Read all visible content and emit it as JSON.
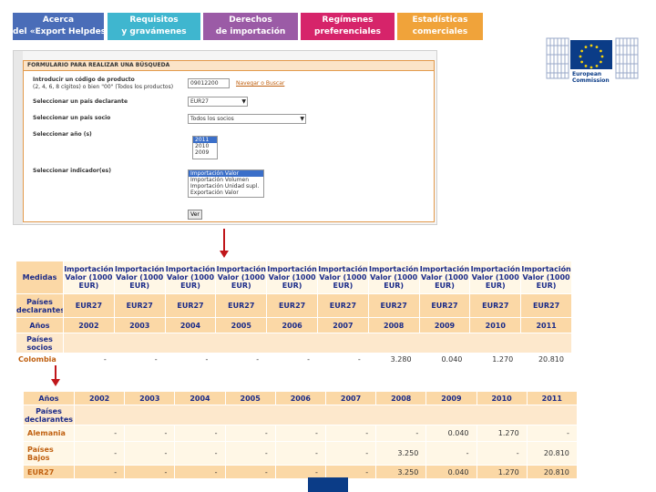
{
  "nav": {
    "tabs": [
      {
        "line1": "Acerca",
        "line2": "del «Export Helpdesk»",
        "color": "#4a6db8"
      },
      {
        "line1": "Requisitos",
        "line2": "y gravámenes",
        "color": "#3fb6cf"
      },
      {
        "line1": "Derechos",
        "line2": "de importación",
        "color": "#9b5ba6"
      },
      {
        "line1": "Regímenes",
        "line2": "preferenciales",
        "color": "#d6246a"
      },
      {
        "line1": "Estadísticas",
        "line2": "comerciales",
        "color": "#f0a33a"
      }
    ]
  },
  "branding": {
    "line1": "European",
    "line2": "Commission"
  },
  "form": {
    "header": "FORMULARIO PARA REALIZAR UNA BÚSQUEDA",
    "product_label_1": "Introducir un código de producto",
    "product_label_2": "(2, 4, 6, 8 cígitos) o bien \"00\" (Todos los productos)",
    "product_value": "09012200",
    "search_link": "Navegar o Buscar",
    "reporter_label": "Seleccionar un país declarante",
    "reporter_value": "EUR27",
    "partner_label": "Seleccionar un país socio",
    "partner_value": "Todos los socios",
    "year_label": "Seleccionar año (s)",
    "years": [
      "2011",
      "2010",
      "2009"
    ],
    "indicator_label": "Seleccionar indicador(es)",
    "indicators": [
      "Importación Valor",
      "Importación Volumen",
      "Importación Unidad supl.",
      "Exportación Valor"
    ],
    "submit": "Ver"
  },
  "table1": {
    "measures_label": "Medidas",
    "measure_header": "Importación Valor (1000 EUR)",
    "reporters_label": "Países declarantes",
    "reporter": "EUR27",
    "years_label": "Años",
    "years": [
      "2002",
      "2003",
      "2004",
      "2005",
      "2006",
      "2007",
      "2008",
      "2009",
      "2010",
      "2011"
    ],
    "partners_label": "Países socios",
    "partner": "Colombia",
    "values": [
      "-",
      "-",
      "-",
      "-",
      "-",
      "-",
      "3.280",
      "0.040",
      "1.270",
      "20.810"
    ]
  },
  "table2": {
    "years_label": "Años",
    "years": [
      "2002",
      "2003",
      "2004",
      "2005",
      "2006",
      "2007",
      "2008",
      "2009",
      "2010",
      "2011"
    ],
    "reporters_label": "Países declarantes",
    "rows": [
      {
        "label": "Alemania",
        "values": [
          "-",
          "-",
          "-",
          "-",
          "-",
          "-",
          "-",
          "0.040",
          "1.270",
          "-"
        ]
      },
      {
        "label": "Países Bajos",
        "values": [
          "-",
          "-",
          "-",
          "-",
          "-",
          "-",
          "3.250",
          "-",
          "-",
          "20.810"
        ]
      },
      {
        "label": "EUR27",
        "values": [
          "-",
          "-",
          "-",
          "-",
          "-",
          "-",
          "3.250",
          "0.040",
          "1.270",
          "20.810"
        ]
      }
    ]
  }
}
